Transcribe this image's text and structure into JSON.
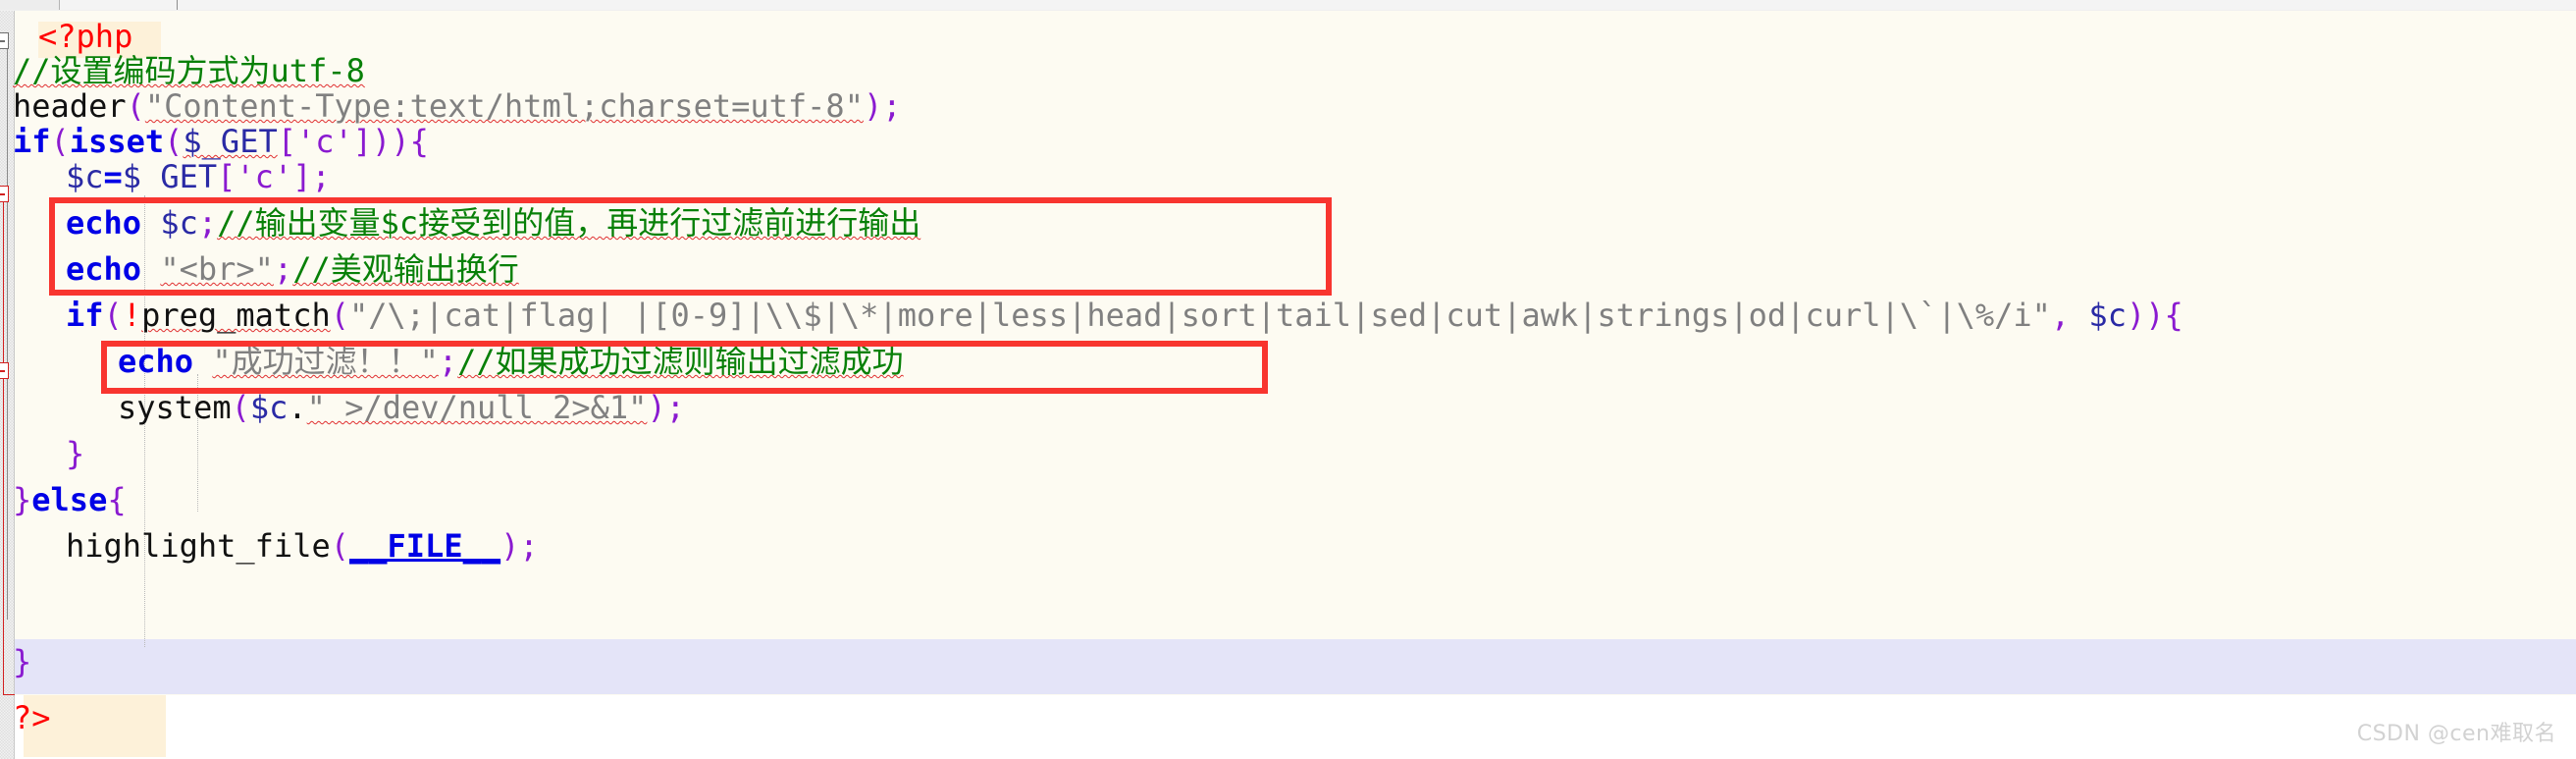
{
  "window": {
    "kind": "code-editor-screenshot",
    "watermark": "CSDN @cen难取名"
  },
  "editor": {
    "language": "php",
    "lines": [
      {
        "id": "l1",
        "text": "<?php"
      },
      {
        "id": "l2",
        "text": "//设置编码方式为utf-8"
      },
      {
        "id": "l3",
        "text": "header(\"Content-Type:text/html;charset=utf-8\");"
      },
      {
        "id": "l4",
        "text": "if(isset($_GET['c'])){"
      },
      {
        "id": "l5",
        "text": "    $c=$ GET['c'];"
      },
      {
        "id": "l6",
        "text": "    echo $c;//输出变量$c接受到的值，再进行过滤前进行输出"
      },
      {
        "id": "l7",
        "text": "    echo \"<br>\";//美观输出换行"
      },
      {
        "id": "l8",
        "text": "    if(!preg_match(\"/\\;|cat|flag| |[0-9]|\\\\$|\\*|more|less|head|sort|tail|sed|cut|awk|strings|od|curl|\\`|\\%/i\", $c)){"
      },
      {
        "id": "l9",
        "text": "        echo \"成功过滤！！\";//如果成功过滤则输出过滤成功"
      },
      {
        "id": "l10",
        "text": "        system($c.\" >/dev/null 2>&1\");"
      },
      {
        "id": "l11",
        "text": "    }"
      },
      {
        "id": "l12",
        "text": "}else{"
      },
      {
        "id": "l13",
        "text": "    highlight_file(__FILE__);"
      },
      {
        "id": "l14",
        "text": "}"
      },
      {
        "id": "l15",
        "text": "?>"
      }
    ],
    "tokens": {
      "php_open": "<?php",
      "php_close": "?>",
      "comment_encoding": "//设置编码方式为utf-8",
      "fn_header": "header",
      "str_content_type": "\"Content-Type:text/html;charset=utf-8\"",
      "kw_if": "if",
      "fn_isset": "isset",
      "var_get_super": "$_GET",
      "str_c_key": "'c'",
      "var_c": "$c",
      "assign_rhs": "$ GET",
      "kw_echo": "echo",
      "comment_echo_c": "//输出变量$c接受到的值，再进行过滤前进行输出",
      "str_br": "\"<br>\"",
      "comment_br": "//美观输出换行",
      "fn_preg_match": "preg_match",
      "regex_blacklist": "\"/\\;|cat|flag| |[0-9]|\\\\$|\\*|more|less|head|sort|tail|sed|cut|awk|strings|od|curl|\\`|\\%/i\"",
      "str_success": "\"成功过滤！！\"",
      "comment_success": "//如果成功过滤则输出过滤成功",
      "fn_system": "system",
      "str_devnull": "\" >/dev/null 2>&1\"",
      "kw_else": "}else{",
      "fn_highlight_file": "highlight_file",
      "const_file": "__FILE__",
      "brace_close": "}"
    },
    "colors": {
      "background": "#fdfbf2",
      "php_tag": "#ff0000",
      "comment": "#088008",
      "keyword": "#0000e6",
      "string": "#808080",
      "punctuation": "#8a1ad0",
      "variable": "#2a2aa5",
      "plain": "#111111",
      "current_line": "#e4e4f8",
      "php_tag_highlight": "#fdf1d9",
      "annotation_box": "#f8352f"
    }
  },
  "annotations": [
    {
      "id": "box-echo-pair",
      "label": "red-highlight-box-echo-output"
    },
    {
      "id": "box-echo-success",
      "label": "red-highlight-box-filter-success"
    }
  ]
}
